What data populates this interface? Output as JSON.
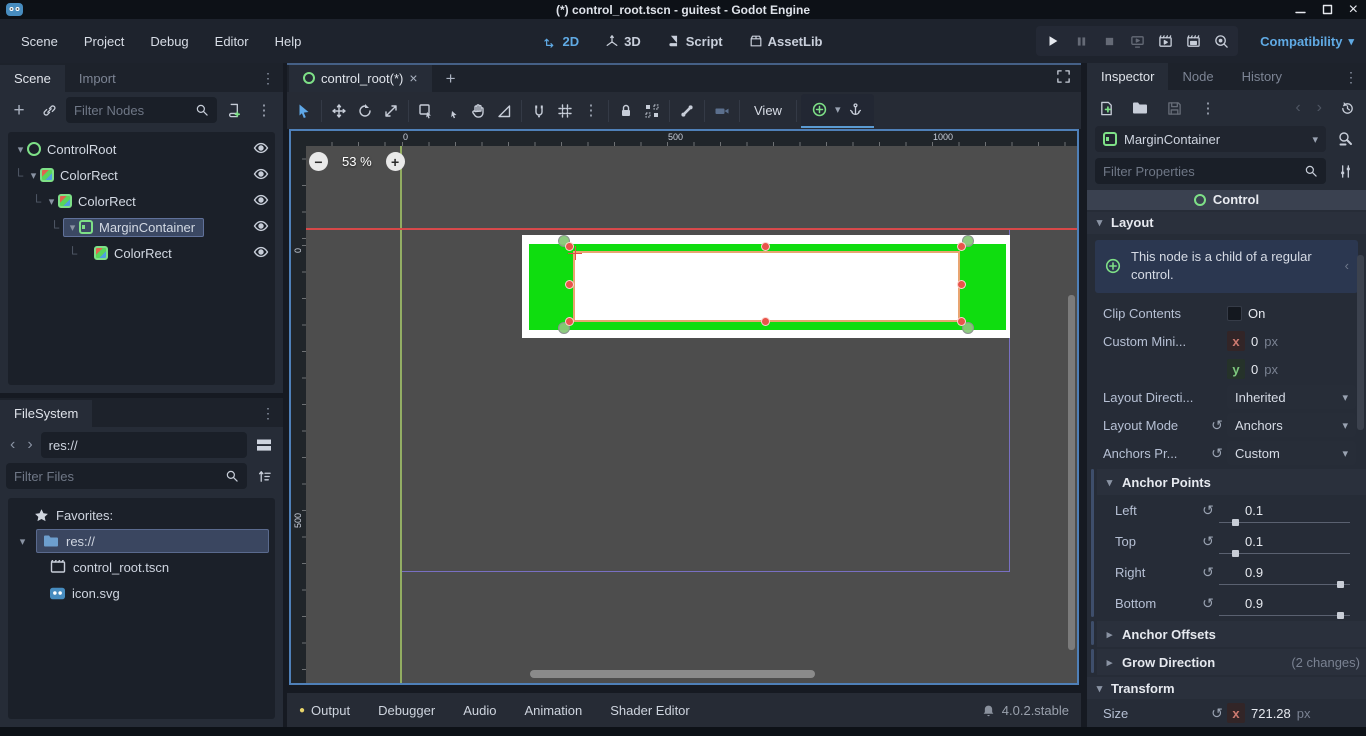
{
  "window": {
    "title": "(*) control_root.tscn - guitest - Godot Engine"
  },
  "icons": {
    "dots": "⋮",
    "close": "×",
    "plus": "+",
    "back": "‹",
    "forward": "›",
    "chev_down": "▾",
    "chev_right": "▸",
    "collapse": "‹",
    "elbow": "└",
    "revert": "↺",
    "zoom_out": "−",
    "zoom_in": "+",
    "bullet": "●",
    "minimize": "—"
  },
  "menubar": {
    "menus": [
      "Scene",
      "Project",
      "Debug",
      "Editor",
      "Help"
    ],
    "workspaces": [
      "2D",
      "3D",
      "Script",
      "AssetLib"
    ],
    "active_workspace": "2D",
    "renderer": "Compatibility"
  },
  "scene_dock": {
    "tabs": [
      "Scene",
      "Import"
    ],
    "filter_placeholder": "Filter Nodes",
    "nodes": [
      {
        "name": "ControlRoot",
        "type": "Control"
      },
      {
        "name": "ColorRect",
        "type": "ColorRect"
      },
      {
        "name": "ColorRect",
        "type": "ColorRect"
      },
      {
        "name": "MarginContainer",
        "type": "MarginContainer",
        "selected": true
      },
      {
        "name": "ColorRect",
        "type": "ColorRect"
      }
    ]
  },
  "filesystem_dock": {
    "title": "FileSystem",
    "path": "res://",
    "filter_placeholder": "Filter Files",
    "favorites_label": "Favorites:",
    "items": [
      {
        "name": "res://",
        "selected": true
      },
      {
        "name": "control_root.tscn"
      },
      {
        "name": "icon.svg"
      }
    ]
  },
  "viewport": {
    "tab_label": "control_root(*)",
    "view_menu": "View",
    "zoom_label": "53 %",
    "ruler_top": [
      "0",
      "500",
      "1000"
    ],
    "ruler_left": [
      "0",
      "500"
    ]
  },
  "bottom_bar": {
    "panels": [
      "Output",
      "Debugger",
      "Audio",
      "Animation",
      "Shader Editor"
    ],
    "version": "4.0.2.stable"
  },
  "inspector": {
    "tabs": [
      "Inspector",
      "Node",
      "History"
    ],
    "node_name": "MarginContainer",
    "filter_placeholder": "Filter Properties",
    "category": "Control",
    "layout_section": "Layout",
    "transform_section": "Transform",
    "notice": "This node is a child of a regular control.",
    "properties": {
      "clip_contents": {
        "label": "Clip Contents",
        "value": "On"
      },
      "custom_minimum_size": {
        "label": "Custom Mini...",
        "x_key": "x",
        "x_value": "0",
        "y_key": "y",
        "y_value": "0",
        "unit": "px"
      },
      "layout_direction": {
        "label": "Layout Directi...",
        "value": "Inherited"
      },
      "layout_mode": {
        "label": "Layout Mode",
        "value": "Anchors"
      },
      "anchors_preset": {
        "label": "Anchors Pr...",
        "value": "Custom"
      },
      "anchor_points": {
        "label": "Anchor Points",
        "left_label": "Left",
        "left": "0.1",
        "top_label": "Top",
        "top": "0.1",
        "right_label": "Right",
        "right": "0.9",
        "bottom_label": "Bottom",
        "bottom": "0.9"
      },
      "anchor_offsets": {
        "label": "Anchor Offsets"
      },
      "grow_direction": {
        "label": "Grow Direction",
        "badge": "(2 changes)"
      },
      "size": {
        "label": "Size",
        "x_key": "x",
        "x_value": "721.28",
        "unit": "px"
      }
    }
  }
}
